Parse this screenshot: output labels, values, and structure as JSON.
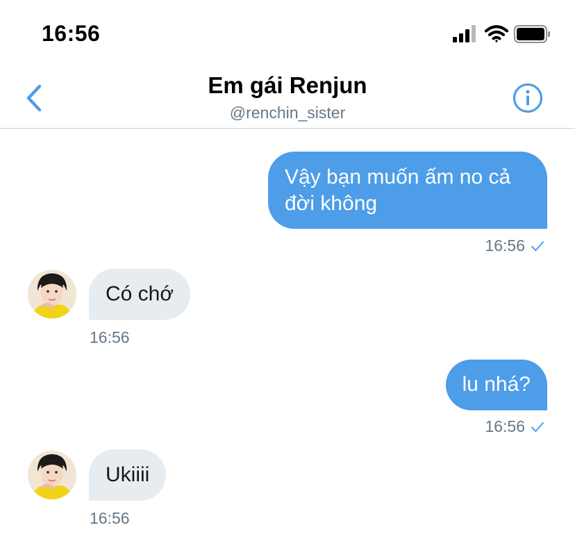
{
  "status_bar": {
    "time": "16:56",
    "icons": [
      "cellular-signal-icon",
      "wifi-icon",
      "battery-icon"
    ]
  },
  "header": {
    "title": "Em gái Renjun",
    "handle": "@renchin_sister",
    "back_icon": "chevron-left-icon",
    "info_icon": "info-icon"
  },
  "messages": [
    {
      "direction": "outgoing",
      "text": "Vậy bạn muốn ấm no cả đời không",
      "time": "16:56",
      "seen": true
    },
    {
      "direction": "incoming",
      "text": "Có chớ",
      "time": "16:56"
    },
    {
      "direction": "outgoing",
      "text": "lu nhá?",
      "time": "16:56",
      "seen": true
    },
    {
      "direction": "incoming",
      "text": "Ukiiii",
      "time": "16:56"
    }
  ],
  "colors": {
    "accent": "#4d9de8",
    "incoming_bubble": "#e6ecf0",
    "secondary_text": "#657786"
  }
}
